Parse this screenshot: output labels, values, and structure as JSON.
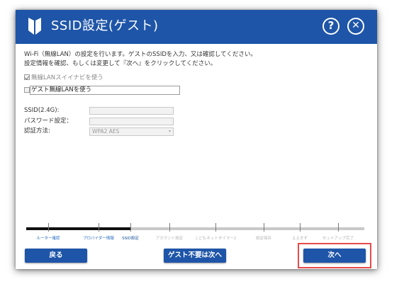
{
  "window": {
    "title": "SSID設定(ゲスト)",
    "help_glyph": "?",
    "close_glyph": "✕"
  },
  "description": {
    "line1": "Wi-Fi（無線LAN）の設定を行います。ゲストのSSIDを入力、又は確認してください。",
    "line2": "設定情報を確認、もしくは変更して『次へ』をクリックしてください。"
  },
  "options": {
    "use_repeater_label": "無線LANスイイナビを使う",
    "use_repeater_checked": true,
    "use_guest_label": "ゲスト無線LANを使う",
    "use_guest_checked": false
  },
  "form": {
    "ssid_label": "SSID(2.4G):",
    "ssid_value": "",
    "password_label": "パスワード設定：",
    "password_value": "",
    "auth_label": "認証方法:",
    "auth_value": "WPA2 AES",
    "auth_arrow": "▾"
  },
  "progress": {
    "current_step_index": 2,
    "steps": [
      {
        "label": "ルーター確認",
        "state": "done"
      },
      {
        "label": "プロバイダー情報",
        "state": "done"
      },
      {
        "label": "SSID設定",
        "state": "current"
      },
      {
        "label": "アカウント設定",
        "state": "pending"
      },
      {
        "label": "こどもネットタイマー2",
        "state": "pending"
      },
      {
        "label": "設定保存",
        "state": "pending"
      },
      {
        "label": "ええきず",
        "state": "pending"
      },
      {
        "label": "セットアップ完了",
        "state": "pending"
      }
    ]
  },
  "buttons": {
    "back": "戻る",
    "skip": "ゲスト不要は次へ",
    "next": "次へ"
  },
  "colors": {
    "brand": "#1e55a8",
    "highlight": "#e84a4a"
  }
}
